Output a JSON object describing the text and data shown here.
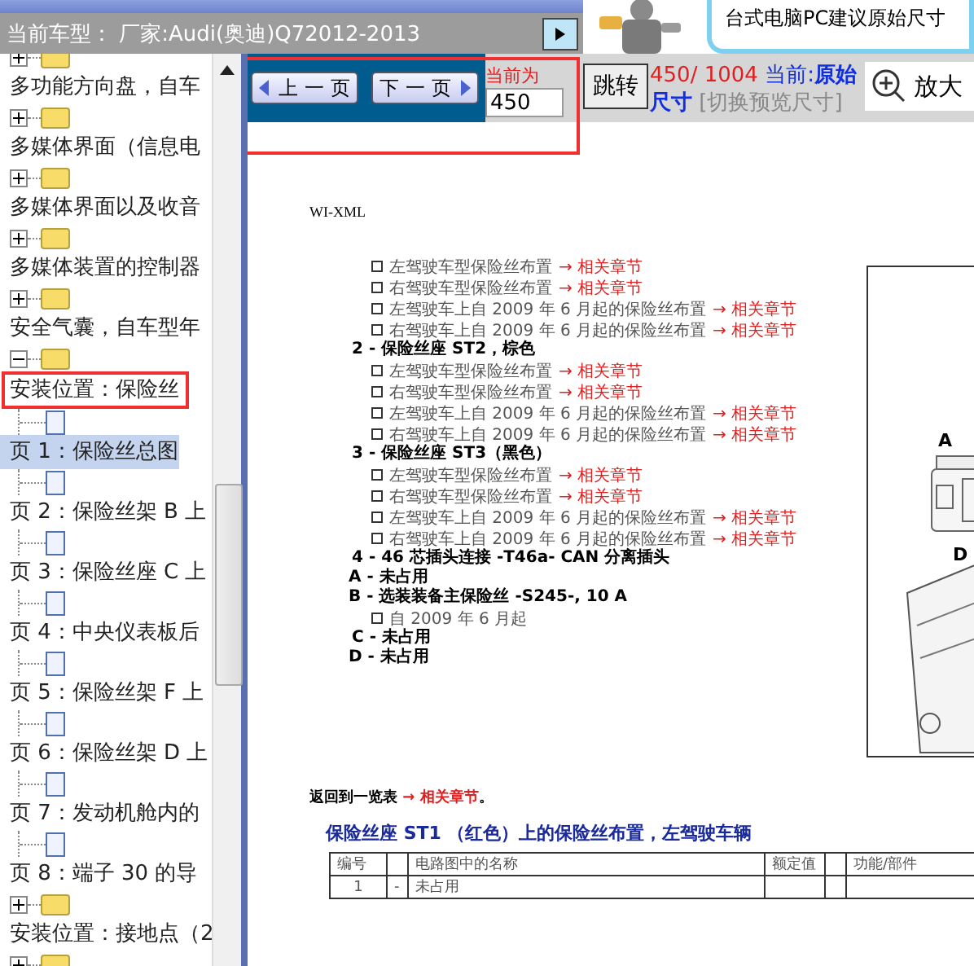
{
  "header": {
    "title": "当前车型： 厂家:Audi(奥迪)Q72012-2013",
    "banner_text": "台式电脑PC建议原始尺寸"
  },
  "tree": [
    {
      "label": "多功能方向盘，自车",
      "expanded": false
    },
    {
      "label": "多媒体界面（信息电",
      "expanded": false
    },
    {
      "label": "多媒体界面以及收音",
      "expanded": false
    },
    {
      "label": "多媒体装置的控制器",
      "expanded": false
    },
    {
      "label": "安全气囊，自车型年",
      "expanded": false
    },
    {
      "label": "安装位置：保险丝",
      "expanded": true,
      "highlighted": true,
      "children": [
        {
          "label": "页 1：保险丝总图",
          "selected": true
        },
        {
          "label": "页 2：保险丝架 B 上",
          "selected": false
        },
        {
          "label": "页 3：保险丝座 C 上",
          "selected": false
        },
        {
          "label": "页 4：中央仪表板后",
          "selected": false
        },
        {
          "label": "页 5：保险丝架 F 上",
          "selected": false
        },
        {
          "label": "页 6：保险丝架 D 上",
          "selected": false
        },
        {
          "label": "页 7：发动机舱内的",
          "selected": false
        },
        {
          "label": "页 8：端子 30 的导",
          "selected": false
        }
      ]
    },
    {
      "label": "安装位置：接地点（2",
      "expanded": false
    },
    {
      "expanded": false
    }
  ],
  "toolbar": {
    "highlighted": true,
    "prev_button": "上 一 页",
    "next_button": "下 一 页",
    "page_label": "当前为",
    "page_input": "450",
    "jump_button": "跳转",
    "page_count": "450/ 1004",
    "size_label": "当前:",
    "size_value": "原始尺寸",
    "switch_link": "[切换预览尺寸]",
    "zoom_button": "放大"
  },
  "document": {
    "heading": "WI-XML",
    "lines": [
      {
        "kind": "bullet",
        "text": "左驾驶车型保险丝布置",
        "link": "→ 相关章节"
      },
      {
        "kind": "bullet",
        "text": "右驾驶车型保险丝布置",
        "link": "→ 相关章节"
      },
      {
        "kind": "bullet",
        "text": "左驾驶车上自 2009 年 6 月起的保险丝布置",
        "link": "→ 相关章节"
      },
      {
        "kind": "bullet",
        "text": "右驾驶车上自 2009 年 6 月起的保险丝布置",
        "link": "→ 相关章节"
      },
      {
        "kind": "heading",
        "text": "2 - 保险丝座 ST2，棕色"
      },
      {
        "kind": "bullet",
        "text": "左驾驶车型保险丝布置",
        "link": "→ 相关章节"
      },
      {
        "kind": "bullet",
        "text": "右驾驶车型保险丝布置",
        "link": "→ 相关章节"
      },
      {
        "kind": "bullet",
        "text": "左驾驶车上自 2009 年 6 月起的保险丝布置",
        "link": "→ 相关章节"
      },
      {
        "kind": "bullet",
        "text": "右驾驶车上自 2009 年 6 月起的保险丝布置",
        "link": "→ 相关章节"
      },
      {
        "kind": "heading",
        "text": "3 - 保险丝座 ST3（黑色）"
      },
      {
        "kind": "bullet",
        "text": "左驾驶车型保险丝布置",
        "link": "→ 相关章节"
      },
      {
        "kind": "bullet",
        "text": "右驾驶车型保险丝布置",
        "link": "→ 相关章节"
      },
      {
        "kind": "bullet",
        "text": "左驾驶车上自 2009 年 6 月起的保险丝布置",
        "link": "→ 相关章节"
      },
      {
        "kind": "bullet",
        "text": "右驾驶车上自 2009 年 6 月起的保险丝布置",
        "link": "→ 相关章节"
      },
      {
        "kind": "heading",
        "text": "4 - 46 芯插头连接 -T46a- CAN 分离插头"
      },
      {
        "kind": "heading",
        "text": "A - 未占用"
      },
      {
        "kind": "heading",
        "text": "B - 选装装备主保险丝 -S245-, 10 A"
      },
      {
        "kind": "bullet",
        "text": "自 2009 年 6 月起"
      },
      {
        "kind": "heading",
        "text": "C - 未占用"
      },
      {
        "kind": "heading",
        "text": "D - 未占用"
      }
    ],
    "diagram_labels": [
      "A",
      "D"
    ],
    "back_text": "返回到一览表",
    "back_link": "→ 相关章节",
    "back_end": "。",
    "table_title": "保险丝座 ST1 （红色）上的保险丝布置，左驾驶车辆",
    "table": {
      "columns": [
        "编号",
        null,
        "电路图中的名称",
        "额定值",
        null,
        "功能/部件"
      ],
      "rows": [
        [
          "1",
          "-",
          "未占用",
          null,
          null,
          null
        ]
      ]
    }
  }
}
